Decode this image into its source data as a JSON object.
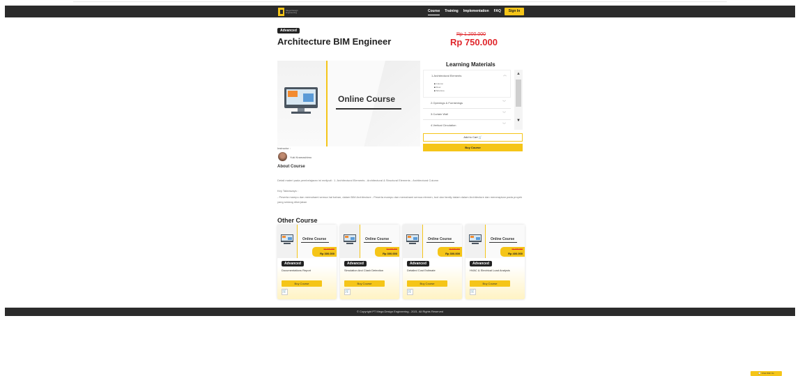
{
  "navbar": {
    "logo_text": "Mega Design Engineering",
    "links": [
      "Course",
      "Training",
      "Implementation",
      "FAQ"
    ],
    "signin": "Sign In"
  },
  "course": {
    "badge": "Advanced",
    "title": "Architecture BIM Engineer",
    "old_price": "Rp 1.200.000",
    "new_price": "Rp 750.000",
    "hero_title": "Online Course"
  },
  "instructor": {
    "label": "Instructor :",
    "name": "Yuki Kramashimo"
  },
  "learning": {
    "title": "Learning Materials",
    "items": [
      {
        "label": "1.Architectural Elements",
        "sub": [
          "Column",
          "Floor",
          "Structure"
        ]
      },
      {
        "label": "2.Openings & Furnishings"
      },
      {
        "label": "3.Curtain Wall"
      },
      {
        "label": "4.Vertical Circulation"
      }
    ],
    "add_cart": "Add to Cart 🛒",
    "buy": "Buy Course"
  },
  "about": {
    "heading": "About Course",
    "desc": "Detail materi pada pembelajaran ini meliputi : 1. Architectural Elements - Architectural & Structural Elements - Architectural Column",
    "key_heading": "Key Takeaways :",
    "key_text": "- Peserta mampu dan memahami semua hal bahan, dalam BIM Architecture - Peserta mampu dan memahami semua elemen, tool dan family dalam dalam Architecture dan menerapkan pada proyek yang sedang dikerjakan"
  },
  "other": {
    "heading": "Other Course",
    "cards": [
      {
        "thumb_title": "Online Course",
        "old_price": "Rp 500.000",
        "price": "Rp 300.000",
        "badge": "Advanced",
        "name": "Documentations Report",
        "buy": "Buy Course",
        "cart": "🛒"
      },
      {
        "thumb_title": "Online Course",
        "old_price": "Rp 500.000",
        "price": "Rp 300.000",
        "badge": "Advanced",
        "name": "Simulation And Clash Detection",
        "buy": "Buy Course",
        "cart": "🛒"
      },
      {
        "thumb_title": "Online Course",
        "old_price": "Rp 500.000",
        "price": "Rp 300.000",
        "badge": "Advanced",
        "name": "Detailed Cost Estimate",
        "buy": "Buy Course",
        "cart": "🛒"
      },
      {
        "thumb_title": "Online Course",
        "old_price": "Rp 600.000",
        "price": "Rp 400.000",
        "badge": "Advanced",
        "name": "HVAC & Electrical Load Analysis",
        "buy": "Buy Course",
        "cart": "🛒"
      }
    ]
  },
  "footer": {
    "text": "© Copyright PT Mega Design Engineering - 2021. All Rights Reserved"
  },
  "chat": {
    "label": "💬 Chat With Us"
  }
}
